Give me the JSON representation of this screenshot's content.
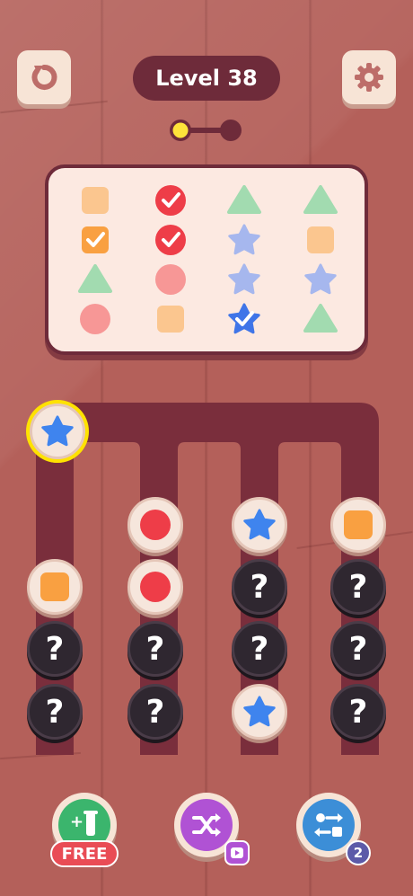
{
  "header": {
    "level_label": "Level 38",
    "restart_icon": "restart-icon",
    "settings_icon": "gear-icon"
  },
  "progress": {
    "stages": 2,
    "current_stage": 1,
    "colors": {
      "active": "#ffe33a",
      "inactive": "#6e2b3a"
    }
  },
  "goal_card": {
    "rows": [
      [
        {
          "shape": "square",
          "color": "#fbc68f",
          "done": false
        },
        {
          "shape": "circle",
          "color": "#ee3d48",
          "done": true
        },
        {
          "shape": "triangle",
          "color": "#a2dbb0",
          "done": false
        },
        {
          "shape": "triangle",
          "color": "#a2dbb0",
          "done": false
        }
      ],
      [
        {
          "shape": "square",
          "color": "#f9a041",
          "done": true
        },
        {
          "shape": "circle",
          "color": "#ee3d48",
          "done": true
        },
        {
          "shape": "star",
          "color": "#a6b7ee",
          "done": false
        },
        {
          "shape": "square",
          "color": "#fbc68f",
          "done": false
        }
      ],
      [
        {
          "shape": "triangle",
          "color": "#a2dbb0",
          "done": false
        },
        {
          "shape": "circle",
          "color": "#f79796",
          "done": false
        },
        {
          "shape": "star",
          "color": "#a6b7ee",
          "done": false
        },
        {
          "shape": "star",
          "color": "#a6b7ee",
          "done": false
        }
      ],
      [
        {
          "shape": "circle",
          "color": "#f79796",
          "done": false
        },
        {
          "shape": "square",
          "color": "#fbc68f",
          "done": false
        },
        {
          "shape": "star",
          "color": "#3f75e8",
          "done": true
        },
        {
          "shape": "triangle",
          "color": "#a2dbb0",
          "done": false
        }
      ]
    ]
  },
  "board": {
    "held_token": {
      "shape": "star",
      "color": "#3f84ee"
    },
    "columns": [
      {
        "tokens": [
          "square-orange",
          "hidden",
          "hidden"
        ]
      },
      {
        "tokens": [
          "circle-red",
          "circle-red",
          "hidden",
          "hidden"
        ]
      },
      {
        "tokens": [
          "star-blue",
          "hidden",
          "hidden",
          "star-blue"
        ]
      },
      {
        "tokens": [
          "square-orange",
          "hidden",
          "hidden",
          "hidden"
        ]
      }
    ],
    "hidden_symbol": "?"
  },
  "powerups": {
    "add_tube": {
      "icon": "add-tube-icon",
      "tag": "FREE",
      "color": "#3bb56d"
    },
    "shuffle": {
      "icon": "shuffle-icon",
      "badge_icon": "video-ad-icon",
      "color": "#b052d4"
    },
    "swap": {
      "icon": "swap-icon",
      "count": "2",
      "color": "#3c8ed7"
    }
  }
}
